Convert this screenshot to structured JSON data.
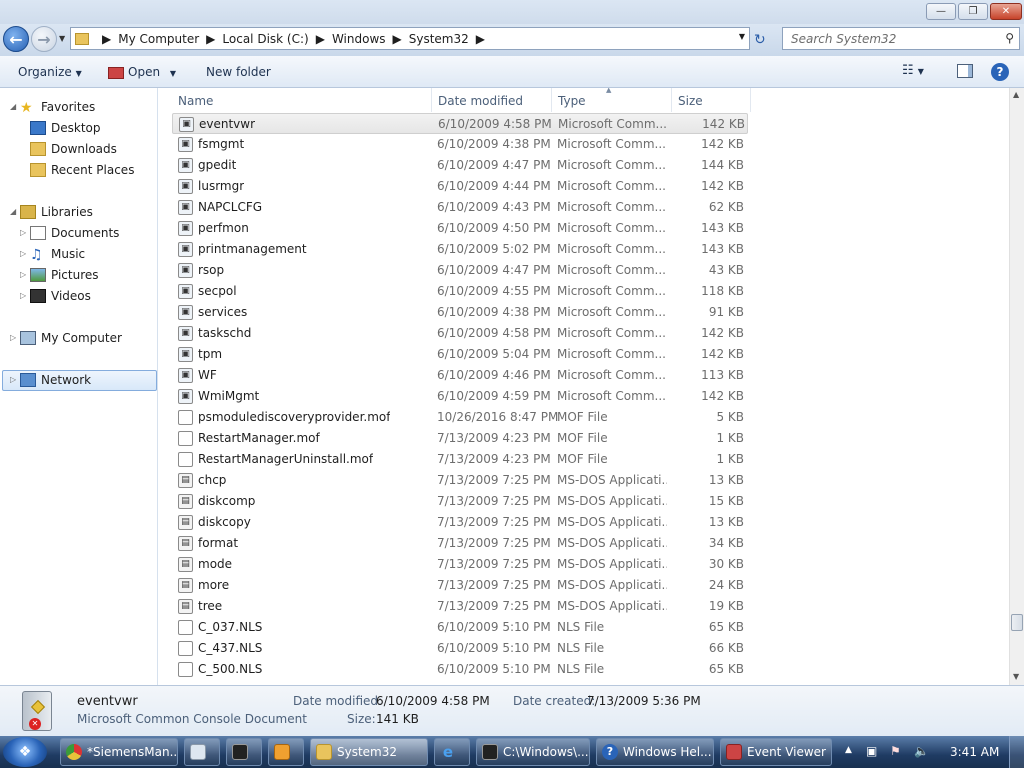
{
  "window": {
    "minimize_icon": "minimize-icon",
    "maximize_icon": "restore-icon",
    "close_icon": "close-icon"
  },
  "address": {
    "breadcrumbs": [
      "My Computer",
      "Local Disk (C:)",
      "Windows",
      "System32"
    ],
    "search_placeholder": "Search System32"
  },
  "toolbar": {
    "organize": "Organize",
    "open": "Open",
    "new_folder": "New folder"
  },
  "nav": {
    "favorites": "Favorites",
    "desktop": "Desktop",
    "downloads": "Downloads",
    "recent_places": "Recent Places",
    "libraries": "Libraries",
    "documents": "Documents",
    "music": "Music",
    "pictures": "Pictures",
    "videos": "Videos",
    "my_computer": "My Computer",
    "network": "Network"
  },
  "columns": {
    "name": "Name",
    "date": "Date modified",
    "type": "Type",
    "size": "Size"
  },
  "files": [
    {
      "name": "eventvwr",
      "date": "6/10/2009 4:58 PM",
      "type": "Microsoft Comm...",
      "size": "142 KB"
    },
    {
      "name": "fsmgmt",
      "date": "6/10/2009 4:38 PM",
      "type": "Microsoft Comm...",
      "size": "142 KB"
    },
    {
      "name": "gpedit",
      "date": "6/10/2009 4:47 PM",
      "type": "Microsoft Comm...",
      "size": "144 KB"
    },
    {
      "name": "lusrmgr",
      "date": "6/10/2009 4:44 PM",
      "type": "Microsoft Comm...",
      "size": "142 KB"
    },
    {
      "name": "NAPCLCFG",
      "date": "6/10/2009 4:43 PM",
      "type": "Microsoft Comm...",
      "size": "62 KB"
    },
    {
      "name": "perfmon",
      "date": "6/10/2009 4:50 PM",
      "type": "Microsoft Comm...",
      "size": "143 KB"
    },
    {
      "name": "printmanagement",
      "date": "6/10/2009 5:02 PM",
      "type": "Microsoft Comm...",
      "size": "143 KB"
    },
    {
      "name": "rsop",
      "date": "6/10/2009 4:47 PM",
      "type": "Microsoft Comm...",
      "size": "43 KB"
    },
    {
      "name": "secpol",
      "date": "6/10/2009 4:55 PM",
      "type": "Microsoft Comm...",
      "size": "118 KB"
    },
    {
      "name": "services",
      "date": "6/10/2009 4:38 PM",
      "type": "Microsoft Comm...",
      "size": "91 KB"
    },
    {
      "name": "taskschd",
      "date": "6/10/2009 4:58 PM",
      "type": "Microsoft Comm...",
      "size": "142 KB"
    },
    {
      "name": "tpm",
      "date": "6/10/2009 5:04 PM",
      "type": "Microsoft Comm...",
      "size": "142 KB"
    },
    {
      "name": "WF",
      "date": "6/10/2009 4:46 PM",
      "type": "Microsoft Comm...",
      "size": "113 KB"
    },
    {
      "name": "WmiMgmt",
      "date": "6/10/2009 4:59 PM",
      "type": "Microsoft Comm...",
      "size": "142 KB"
    },
    {
      "name": "psmodulediscoveryprovider.mof",
      "date": "10/26/2016 8:47 PM",
      "type": "MOF File",
      "size": "5 KB"
    },
    {
      "name": "RestartManager.mof",
      "date": "7/13/2009 4:23 PM",
      "type": "MOF File",
      "size": "1 KB"
    },
    {
      "name": "RestartManagerUninstall.mof",
      "date": "7/13/2009 4:23 PM",
      "type": "MOF File",
      "size": "1 KB"
    },
    {
      "name": "chcp",
      "date": "7/13/2009 7:25 PM",
      "type": "MS-DOS Applicati...",
      "size": "13 KB"
    },
    {
      "name": "diskcomp",
      "date": "7/13/2009 7:25 PM",
      "type": "MS-DOS Applicati...",
      "size": "15 KB"
    },
    {
      "name": "diskcopy",
      "date": "7/13/2009 7:25 PM",
      "type": "MS-DOS Applicati...",
      "size": "13 KB"
    },
    {
      "name": "format",
      "date": "7/13/2009 7:25 PM",
      "type": "MS-DOS Applicati...",
      "size": "34 KB"
    },
    {
      "name": "mode",
      "date": "7/13/2009 7:25 PM",
      "type": "MS-DOS Applicati...",
      "size": "30 KB"
    },
    {
      "name": "more",
      "date": "7/13/2009 7:25 PM",
      "type": "MS-DOS Applicati...",
      "size": "24 KB"
    },
    {
      "name": "tree",
      "date": "7/13/2009 7:25 PM",
      "type": "MS-DOS Applicati...",
      "size": "19 KB"
    },
    {
      "name": "C_037.NLS",
      "date": "6/10/2009 5:10 PM",
      "type": "NLS File",
      "size": "65 KB"
    },
    {
      "name": "C_437.NLS",
      "date": "6/10/2009 5:10 PM",
      "type": "NLS File",
      "size": "66 KB"
    },
    {
      "name": "C_500.NLS",
      "date": "6/10/2009 5:10 PM",
      "type": "NLS File",
      "size": "65 KB"
    }
  ],
  "details": {
    "name": "eventvwr",
    "type": "Microsoft Common Console Document",
    "modified_label": "Date modified:",
    "modified_value": "6/10/2009 4:58 PM",
    "created_label": "Date created:",
    "created_value": "7/13/2009 5:36 PM",
    "size_label": "Size:",
    "size_value": "141 KB"
  },
  "taskbar": {
    "items": [
      "*SiemensMan...",
      "System32",
      "C:\\Windows\\...",
      "Windows Hel...",
      "Event Viewer"
    ],
    "clock": "3:41 AM"
  },
  "colors": {
    "accent": "#3a78c9",
    "selection": "#e8e8e8",
    "taskbar": "#1f3b63"
  }
}
